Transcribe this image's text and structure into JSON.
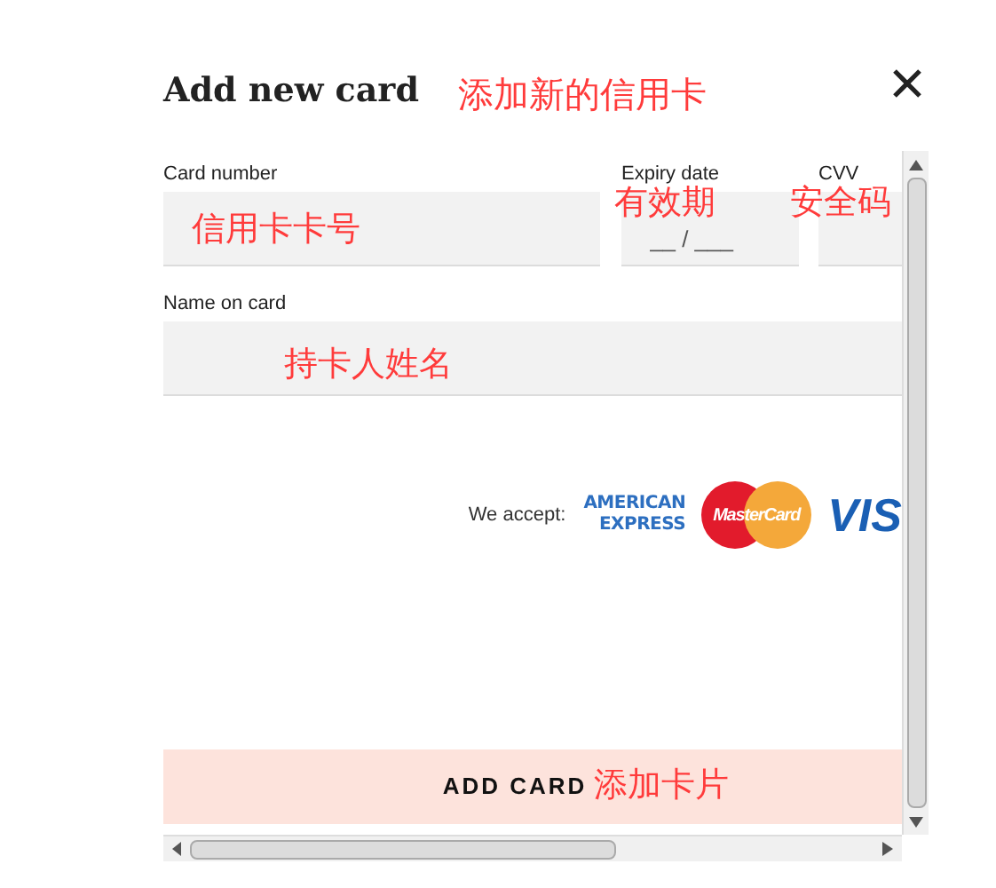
{
  "dialog": {
    "title": "Add new card",
    "title_note": "添加新的信用卡"
  },
  "fields": [
    {
      "label": "Card number",
      "note": "信用卡卡号"
    },
    {
      "label": "Expiry date",
      "placeholder": "__ / ___",
      "note": "有效期"
    },
    {
      "label": "CVV",
      "note": "安全码"
    },
    {
      "label": "Name on card",
      "note": "持卡人姓名"
    }
  ],
  "accept": {
    "label": "We accept:",
    "logos": [
      {
        "kind": "amex",
        "lines": [
          "AMERICAN",
          "EXPRESS"
        ]
      },
      {
        "kind": "mastercard",
        "lines": [
          "MasterCard"
        ]
      },
      {
        "kind": "visa",
        "lines": [
          "VIS"
        ]
      }
    ]
  },
  "submit": {
    "label": "ADD CARD",
    "note": "添加卡片"
  }
}
